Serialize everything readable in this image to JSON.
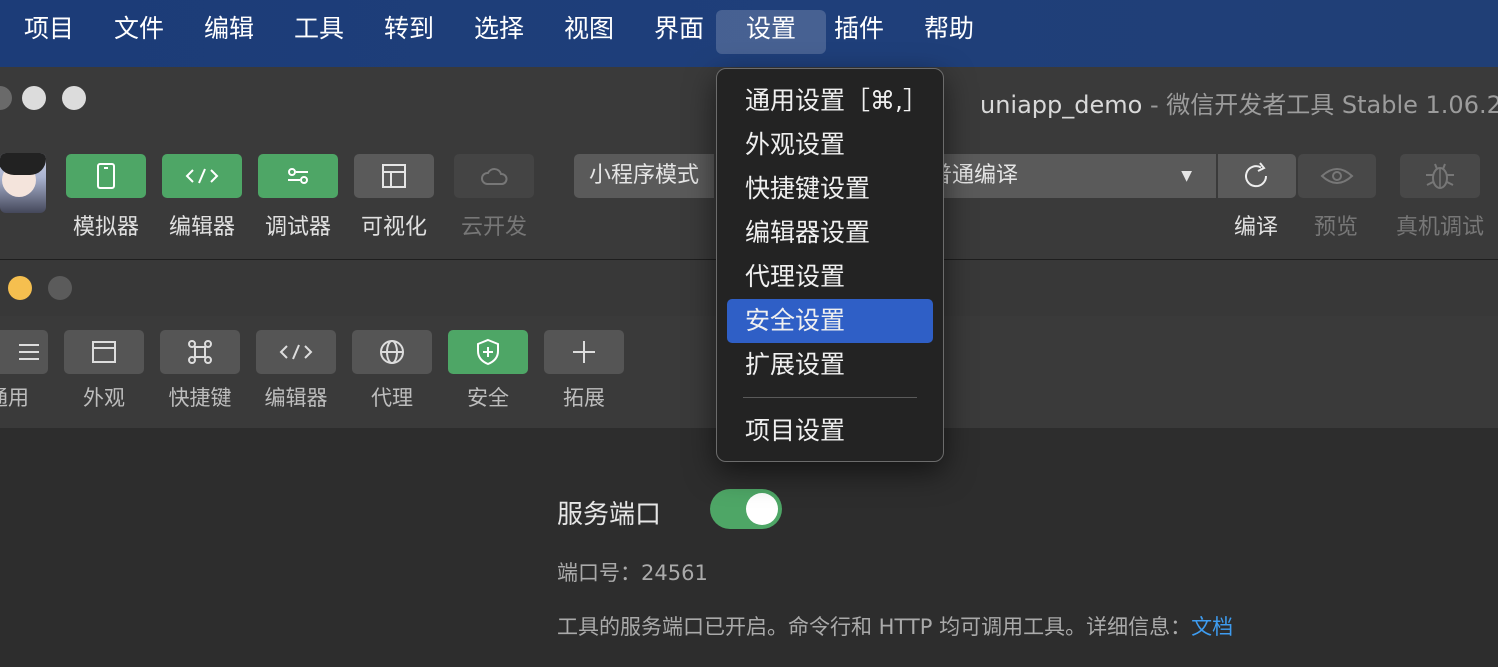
{
  "menubar": {
    "items": [
      "项目",
      "文件",
      "编辑",
      "工具",
      "转到",
      "选择",
      "视图",
      "界面",
      "设置",
      "插件",
      "帮助"
    ],
    "active": "设置"
  },
  "devtools": {
    "title_project": "uniapp_demo",
    "title_app": " - 微信开发者工具 Stable 1.06.2",
    "toolbar": {
      "simulator": "模拟器",
      "editor": "编辑器",
      "debugger": "调试器",
      "visual": "可视化",
      "cloud": "云开发"
    },
    "mode_select": "小程序模式",
    "compile_select": "普通编译",
    "compile_label": "编译",
    "preview_label": "预览",
    "device_debug_label": "真机调试"
  },
  "settings_window": {
    "tabs": {
      "general": "通用",
      "appearance": "外观",
      "shortcut": "快捷键",
      "editor": "编辑器",
      "proxy": "代理",
      "security": "安全",
      "extension": "拓展"
    },
    "service_port_title": "服务端口",
    "service_port_enabled": true,
    "port_number": "端口号：24561",
    "description": "工具的服务端口已开启。命令行和 HTTP 均可调用工具。详细信息：",
    "doc_link": "文档"
  },
  "dropdown": {
    "items": [
      "通用设置［⌘,］",
      "外观设置",
      "快捷键设置",
      "编辑器设置",
      "代理设置",
      "安全设置",
      "扩展设置"
    ],
    "highlighted": "安全设置",
    "after_separator": "项目设置"
  },
  "colors": {
    "menubar": "#1f3f7a",
    "accent_green": "#4ea666",
    "highlight_blue": "#2f5fc6",
    "link": "#3e9cf0"
  }
}
